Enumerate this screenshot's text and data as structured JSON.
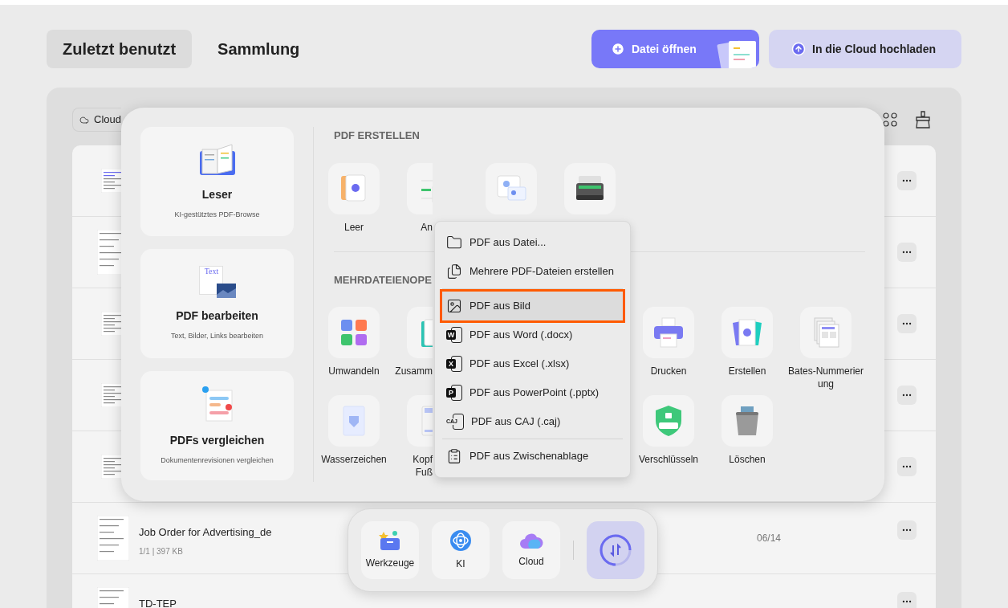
{
  "tabs": [
    {
      "label": "Zuletzt benutzt",
      "selected": true
    },
    {
      "label": "Sammlung",
      "selected": false
    }
  ],
  "actions": [
    {
      "kind": "primary",
      "label": "Datei öffnen"
    },
    {
      "kind": "secondary",
      "label": "In die Cloud hochladen"
    }
  ],
  "filter": {
    "label": "Cloud"
  },
  "files": [
    {
      "kind": "covered"
    },
    {
      "kind": "covered"
    },
    {
      "kind": "covered"
    },
    {
      "kind": "covered"
    },
    {
      "kind": "covered"
    },
    {
      "kind": "file",
      "title": "Job Order for Advertising_de",
      "info": "1/1 | 397 KB",
      "date": "06/14"
    },
    {
      "kind": "file",
      "title": "TD-TEP"
    }
  ],
  "tools_panel": {
    "cards": [
      {
        "title": "Leser",
        "subtitle": "KI-gestütztes PDF-Browse"
      },
      {
        "title": "PDF bearbeiten",
        "subtitle": "Text, Bilder, Links bearbeiten",
        "icon_text": "Text"
      },
      {
        "title": "PDFs vergleichen",
        "subtitle": "Dokumentenrevisionen vergleichen"
      }
    ],
    "sections": [
      {
        "heading": "PDF ERSTELLEN",
        "tiles": [
          {
            "kind": "tool",
            "label": "Leer"
          },
          {
            "kind": "clipped",
            "label": "An"
          },
          {
            "kind": "tool"
          },
          {
            "kind": "tool"
          }
        ]
      },
      {
        "heading": "MEHRDATEIENOPE",
        "tiles": [
          {
            "kind": "tool",
            "label": "Umwandeln"
          },
          {
            "kind": "clipped",
            "label": "Zusamm"
          },
          {
            "kind": "hidden"
          },
          {
            "kind": "hidden"
          },
          {
            "kind": "tool",
            "label": "Drucken"
          },
          {
            "kind": "tool",
            "label": "Erstellen"
          },
          {
            "kind": "tool",
            "label": "Bates-Nummerierung"
          },
          {
            "kind": "tool",
            "label": "Wasserzeichen"
          },
          {
            "kind": "clipped",
            "label": "Kopf\nFuß"
          },
          {
            "kind": "hidden"
          },
          {
            "kind": "hidden"
          },
          {
            "kind": "tool",
            "label": "Verschlüsseln"
          },
          {
            "kind": "tool",
            "label": "Löschen"
          }
        ]
      }
    ]
  },
  "menu": {
    "groups": [
      [
        {
          "kind": "folder",
          "label": "PDF aus Datei...",
          "selected": false
        },
        {
          "kind": "files",
          "label": "Mehrere PDF-Dateien erstellen",
          "selected": false
        }
      ],
      [
        {
          "kind": "image",
          "label": "PDF aus Bild",
          "selected": true
        },
        {
          "kind": "badge",
          "badge": "W",
          "label": "PDF aus Word (.docx)",
          "selected": false
        },
        {
          "kind": "badge",
          "badge": "X",
          "label": "PDF aus Excel (.xlsx)",
          "selected": false
        },
        {
          "kind": "badge",
          "badge": "P",
          "label": "PDF aus PowerPoint (.pptx)",
          "selected": false
        },
        {
          "kind": "outline-badge",
          "badge": "CAJ",
          "label": "PDF aus CAJ (.caj)",
          "selected": false
        }
      ],
      [
        {
          "kind": "clipboard",
          "label": "PDF aus Zwischenablage",
          "selected": false
        }
      ]
    ]
  },
  "dock": {
    "items": [
      {
        "kind": "tool",
        "label": "Werkzeuge",
        "selected": false
      },
      {
        "kind": "tool",
        "label": "KI",
        "selected": false
      },
      {
        "kind": "tool",
        "label": "Cloud",
        "selected": false
      },
      {
        "kind": "sync",
        "selected": true
      }
    ]
  }
}
